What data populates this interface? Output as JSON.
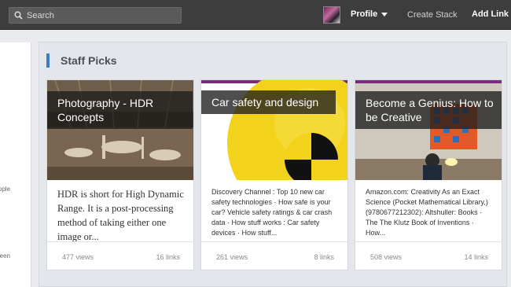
{
  "header": {
    "search_placeholder": "Search",
    "profile_label": "Profile",
    "create_stack_label": "Create Stack",
    "add_link_label": "Add Link"
  },
  "sidebar": {
    "fragment_1": "ople",
    "fragment_2": "een"
  },
  "section": {
    "title": "Staff Picks"
  },
  "cards": [
    {
      "title": "Photography - HDR Concepts",
      "description": "HDR is short for High Dynamic Range. It is a post-processing method of taking either one image or...",
      "views": "477 views",
      "links": "16 links"
    },
    {
      "title": "Car safety and design",
      "description": "Discovery Channel : Top 10 new car safety technologies · How safe is your car? Vehicle safety ratings & car crash data · How stuff works : Car safety devices · How stuff...",
      "views": "261 views",
      "links": "8 links"
    },
    {
      "title": "Become a Genius: How to be Creative",
      "description": "Amazon.com: Creativity As an Exact Science (Pocket Mathematical Library,) (9780677212302): Altshuller: Books · The The Klutz Book of Inventions · How...",
      "views": "508 views",
      "links": "14 links"
    }
  ],
  "colors": {
    "topbar": "#3d3d3d",
    "accent": "#3b7cc4",
    "card_strip": "#7a2b7a"
  }
}
